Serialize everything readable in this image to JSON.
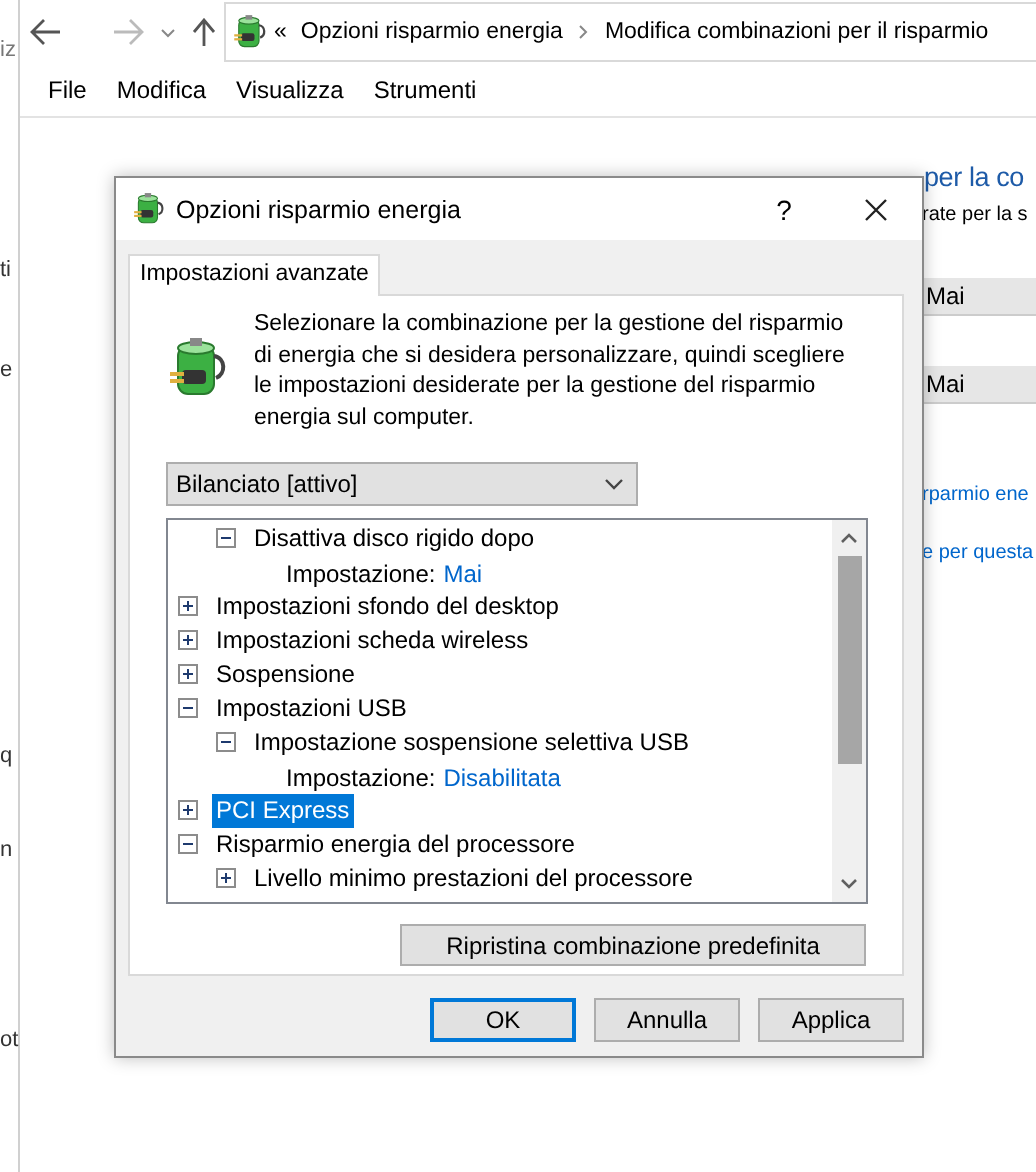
{
  "explorer": {
    "left_strip": [
      "iz",
      "ti",
      "e",
      "q",
      "n",
      "ot"
    ],
    "address": {
      "prefix": "«",
      "crumbs": [
        "Opzioni risparmio energia",
        "Modifica combinazioni per il risparmio"
      ]
    },
    "menu": [
      "File",
      "Modifica",
      "Visualizza",
      "Strumenti"
    ],
    "heading": "per la co",
    "subtitle": "rate per la s",
    "fields": [
      "Mai",
      "Mai"
    ],
    "links": [
      "rparmio ene",
      "e per questa"
    ]
  },
  "dialog": {
    "title": "Opzioni risparmio energia",
    "help": "?",
    "tabs": [
      {
        "label": "Impostazioni avanzate",
        "selected": true
      }
    ],
    "description": "Selezionare la combinazione per la gestione del risparmio di energia che si desidera personalizzare, quindi scegliere le impostazioni desiderate per la gestione del risparmio energia sul computer.",
    "plan": "Bilanciato [attivo]",
    "tree": [
      {
        "children": [
          {
            "kind": "node",
            "label": "Disattiva disco rigido dopo",
            "expanded": true,
            "selected": false,
            "children": [
              {
                "kind": "setting",
                "label": "Impostazione:",
                "value": "Mai"
              }
            ]
          }
        ]
      },
      {
        "kind": "node",
        "label": "Impostazioni sfondo del desktop",
        "expanded": false,
        "selected": false
      },
      {
        "kind": "node",
        "label": "Impostazioni scheda wireless",
        "expanded": false,
        "selected": false
      },
      {
        "kind": "node",
        "label": "Sospensione",
        "expanded": false,
        "selected": false
      },
      {
        "kind": "node",
        "label": "Impostazioni USB",
        "expanded": true,
        "selected": false,
        "children": [
          {
            "kind": "node",
            "label": "Impostazione sospensione selettiva USB",
            "expanded": true,
            "selected": false,
            "children": [
              {
                "kind": "setting",
                "label": "Impostazione:",
                "value": "Disabilitata"
              }
            ]
          }
        ]
      },
      {
        "kind": "node",
        "label": "PCI Express",
        "expanded": false,
        "selected": true
      },
      {
        "kind": "node",
        "label": "Risparmio energia del processore",
        "expanded": true,
        "selected": false,
        "children": [
          {
            "kind": "node",
            "label": "Livello minimo prestazioni del processore",
            "expanded": false,
            "selected": false
          }
        ]
      }
    ],
    "restore_button": "Ripristina combinazione predefinita",
    "buttons": [
      {
        "label": "OK",
        "default": true
      },
      {
        "label": "Annulla",
        "default": false
      },
      {
        "label": "Applica",
        "default": false
      }
    ]
  }
}
